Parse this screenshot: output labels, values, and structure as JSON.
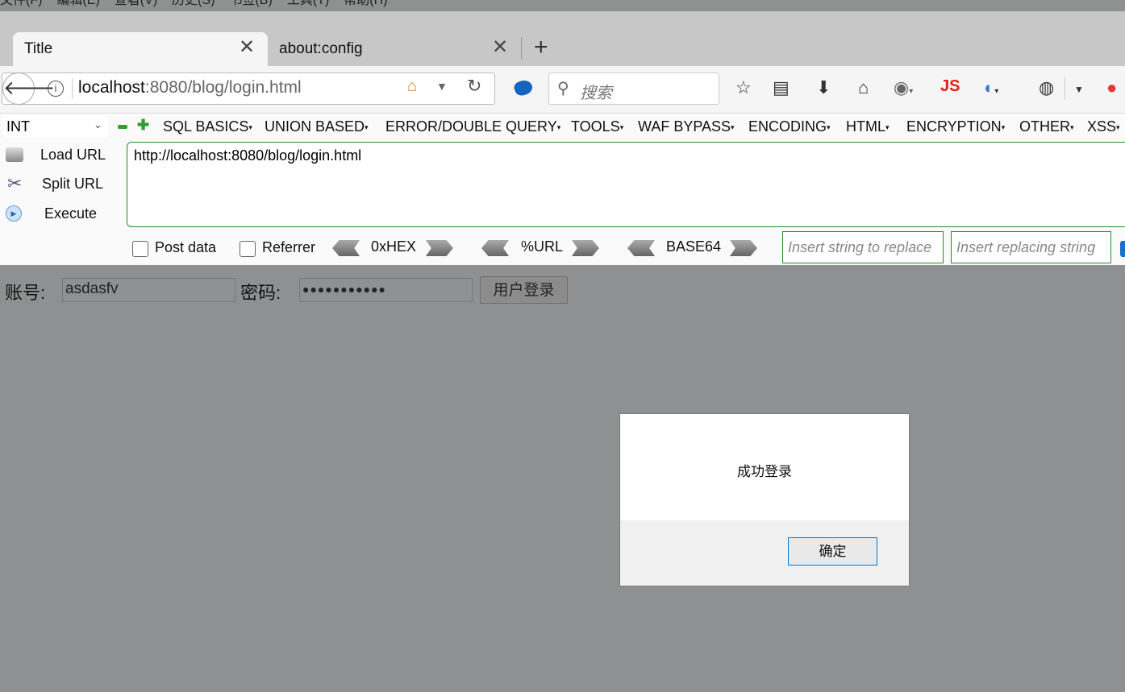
{
  "menubar": [
    "文件(F)",
    "编辑(E)",
    "查看(V)",
    "历史(S)",
    "书签(B)",
    "工具(T)",
    "帮助(H)"
  ],
  "tabs": [
    {
      "title": "Title",
      "active": true
    },
    {
      "title": "about:config",
      "active": false
    }
  ],
  "navbar": {
    "url_host": "localhost",
    "url_rest": ":8080/blog/login.html",
    "search_placeholder": "搜索",
    "js_label": "JS"
  },
  "hackbar": {
    "type_select": "INT",
    "menus": [
      "SQL BASICS",
      "UNION BASED",
      "ERROR/DOUBLE QUERY",
      "TOOLS",
      "WAF BYPASS",
      "ENCODING",
      "HTML",
      "ENCRYPTION",
      "OTHER",
      "XSS"
    ],
    "load_url": "Load URL",
    "split_url": "Split URL",
    "execute": "Execute",
    "url_value": "http://localhost:8080/blog/login.html",
    "post_data": "Post data",
    "referrer": "Referrer",
    "hex": "0xHEX",
    "url_enc": "%URL",
    "base64": "BASE64",
    "replace_placeholder": "Insert string to replace",
    "replacing_placeholder": "Insert replacing string"
  },
  "form": {
    "account_label": "账号:",
    "account_value": "asdasfv",
    "password_label": "密码:",
    "password_value": "●●●●●●●●●●●",
    "login_button": "用户登录"
  },
  "dialog": {
    "message": "成功登录",
    "ok": "确定"
  },
  "colors": {
    "page_bg": "#8f9091",
    "hackbar_green": "#2a8a2a",
    "dialog_focus": "#0078d7"
  }
}
